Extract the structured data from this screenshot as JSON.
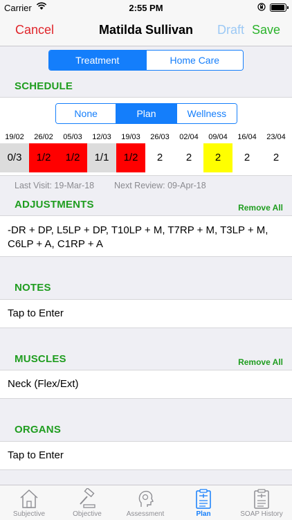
{
  "status_bar": {
    "carrier": "Carrier",
    "time": "2:55 PM"
  },
  "nav": {
    "cancel": "Cancel",
    "title": "Matilda Sullivan",
    "draft": "Draft",
    "save": "Save"
  },
  "top_segment": {
    "options": [
      "Treatment",
      "Home Care"
    ],
    "selected": "Treatment"
  },
  "schedule": {
    "title": "SCHEDULE",
    "segment": {
      "options": [
        "None",
        "Plan",
        "Wellness"
      ],
      "selected": "Plan"
    },
    "dates": [
      "19/02",
      "26/02",
      "05/03",
      "12/03",
      "19/03",
      "26/03",
      "02/04",
      "09/04",
      "16/04",
      "23/04"
    ],
    "cells": [
      {
        "value": "0/3",
        "color": "#dcdcdc"
      },
      {
        "value": "1/2",
        "color": "#ff0000"
      },
      {
        "value": "1/2",
        "color": "#ff0000"
      },
      {
        "value": "1/1",
        "color": "#dcdcdc"
      },
      {
        "value": "1/2",
        "color": "#ff0000"
      },
      {
        "value": "2",
        "color": "#ffffff"
      },
      {
        "value": "2",
        "color": "#ffffff"
      },
      {
        "value": "2",
        "color": "#ffff00"
      },
      {
        "value": "2",
        "color": "#ffffff"
      },
      {
        "value": "2",
        "color": "#ffffff"
      }
    ],
    "last_visit": "Last Visit: 19-Mar-18",
    "next_review": "Next Review: 09-Apr-18"
  },
  "adjustments": {
    "title": "ADJUSTMENTS",
    "remove_all": "Remove All",
    "line1": "-DR + DP, L5LP + DP, T10LP + M, T7RP + M, T3LP + M,",
    "line2": "C6LP + A, C1RP + A"
  },
  "notes": {
    "title": "NOTES",
    "value": "Tap to Enter"
  },
  "muscles": {
    "title": "MUSCLES",
    "remove_all": "Remove All",
    "value": "Neck (Flex/Ext)"
  },
  "organs": {
    "title": "ORGANS",
    "value": "Tap to Enter"
  },
  "tabs": [
    {
      "label": "Subjective",
      "icon": "house-icon"
    },
    {
      "label": "Objective",
      "icon": "gavel-icon"
    },
    {
      "label": "Assessment",
      "icon": "head-icon"
    },
    {
      "label": "Plan",
      "icon": "clipboard-icon",
      "active": true
    },
    {
      "label": "SOAP History",
      "icon": "clipboard-history-icon"
    }
  ],
  "colors": {
    "accent": "#147efb",
    "green": "#1f9d1f",
    "red": "#e0252b"
  }
}
